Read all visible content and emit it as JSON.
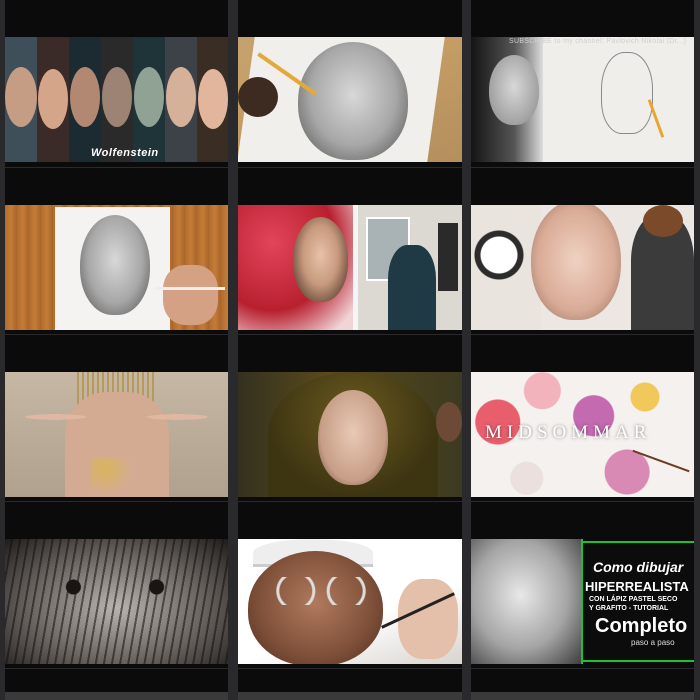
{
  "gallery": {
    "items": [
      {
        "id": "wolfenstein",
        "overlay": "Wolfenstein"
      },
      {
        "id": "pencil-portrait-sketch",
        "overlay": ""
      },
      {
        "id": "subscribe-drawing",
        "overlay": "SUBSCRIBE to my channel: Pavlovich Nikolai (Dr...)"
      },
      {
        "id": "pencil-portrait-desk",
        "overlay": ""
      },
      {
        "id": "painting-headscarf",
        "overlay": ""
      },
      {
        "id": "painting-flowers-face",
        "overlay": ""
      },
      {
        "id": "hands-gold",
        "overlay": ""
      },
      {
        "id": "veiled-woman",
        "overlay": ""
      },
      {
        "id": "midsommar",
        "overlay": "MIDSOMMAR"
      },
      {
        "id": "wet-hair-face",
        "overlay": ""
      },
      {
        "id": "old-man-glasses",
        "overlay": ""
      },
      {
        "id": "tutorial",
        "overlay": "Como dibujar",
        "title2": "HIPERREALISTA",
        "sub1": "CON LÁPIZ PASTEL SECO",
        "sub2": "Y GRAFITO - TUTORIAL",
        "title3": "Completo",
        "sub3": "paso a paso"
      }
    ]
  },
  "colors": {
    "background": "#2a2a2c",
    "cell": "#0b0b0c",
    "tutorial_accent": "#1fbf3a"
  }
}
